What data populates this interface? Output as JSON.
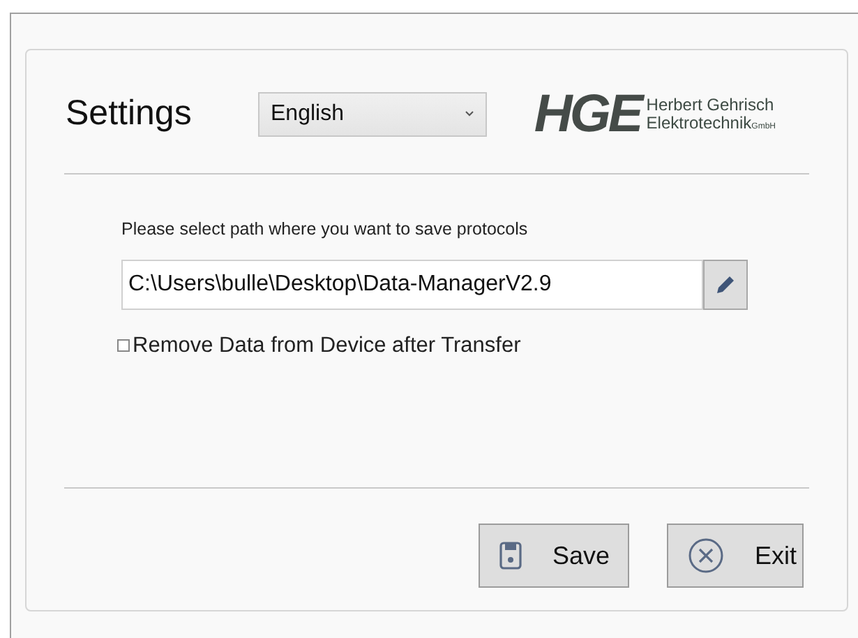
{
  "title": "Settings",
  "language": {
    "value": "English"
  },
  "logo": {
    "mark": "HGE",
    "line_1": "Herbert Gehrisch",
    "line_2": "Elektrotechnik",
    "suffix": "GmbH"
  },
  "path_label": "Please select path where you want to save protocols",
  "path_field": {
    "value": "C:\\Users\\bulle\\Desktop\\Data-ManagerV2.9"
  },
  "remove_option": {
    "label": "Remove Data from Device after Transfer",
    "checked": false
  },
  "buttons": [
    {
      "kind": "save",
      "label": "Save"
    },
    {
      "kind": "exit",
      "label": "Exit"
    }
  ]
}
